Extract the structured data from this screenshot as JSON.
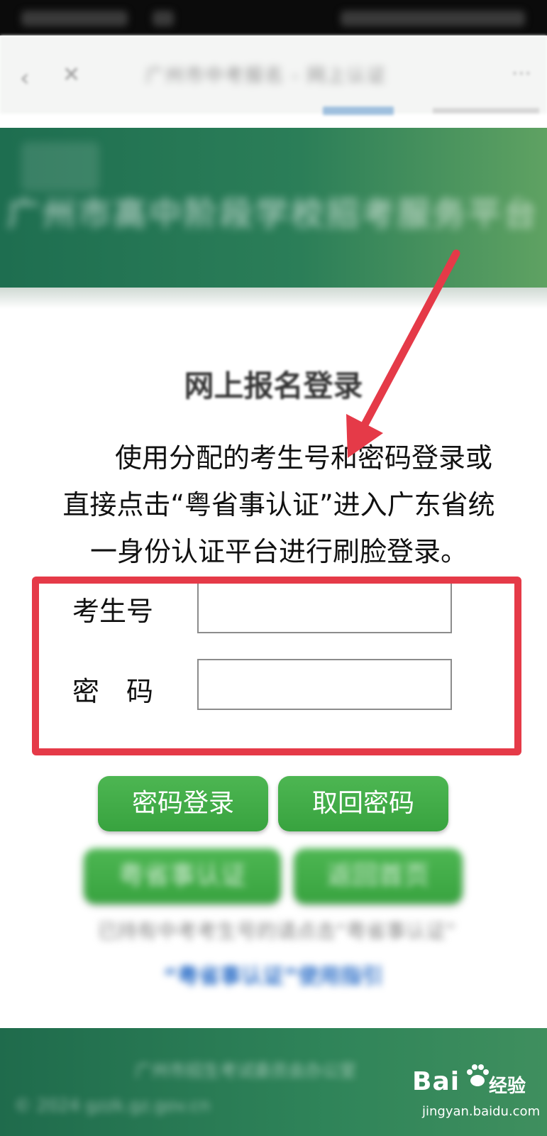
{
  "status_bar": {},
  "browser": {
    "back_icon": "back-arrow-icon",
    "close_icon": "close-icon",
    "title": "广州市中考报名 - 网上认证",
    "more_icon": "more-menu-icon"
  },
  "banner": {
    "title": "广州市高中阶段学校招考服务平台"
  },
  "login": {
    "title": "网上报名登录",
    "instruction_line1": "使用分配的考生号和密码登录或",
    "instruction_line2": "直接点击“粤省事认证”进入广东省统",
    "instruction_line3": "一身份认证平台进行刷脸登录。"
  },
  "form": {
    "exam_no_label": "考生号",
    "exam_no_value": "",
    "password_label": "密　码",
    "password_value": ""
  },
  "buttons": {
    "password_login": "密码登录",
    "retrieve_password": "取回密码",
    "yueshengshi_auth": "粤省事认证",
    "back_home": "返回首页"
  },
  "notice": {
    "text": "已持有中考考生号的请点击“粤省事认证”",
    "guide_link": "“粤省事认证”使用指引"
  },
  "footer": {
    "line1": "广州市招生考试委员会办公室",
    "line2": "©  2024 gzzk.gz.gov.cn"
  },
  "annotations": {
    "arrow_color": "#e53a48",
    "highlight_color": "#e53a48"
  },
  "watermark": {
    "brand": "Bai",
    "brand_suffix": "经验",
    "domain": "jingyan.baidu.com"
  },
  "colors": {
    "button_green": "#3fab45",
    "banner_green": "#1e6e50"
  }
}
